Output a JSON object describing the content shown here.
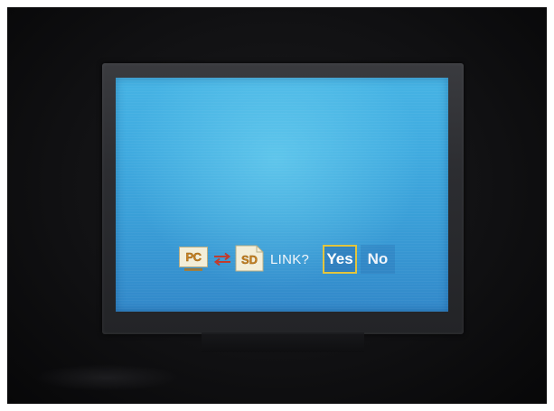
{
  "dialog": {
    "source_label": "PC",
    "target_label": "SD",
    "question": "LINK?",
    "yes_label": "Yes",
    "no_label": "No",
    "selected_option": "Yes"
  },
  "icons": {
    "source": "pc-computer-icon",
    "transfer": "bidirectional-arrows-icon",
    "target": "sd-card-icon"
  },
  "colors": {
    "screen_background": "#3fa7dd",
    "selection_border": "#e3c43a",
    "icon_label": "#c97f1c",
    "arrow_color": "#c0392b",
    "text": "#f2f6fa"
  }
}
